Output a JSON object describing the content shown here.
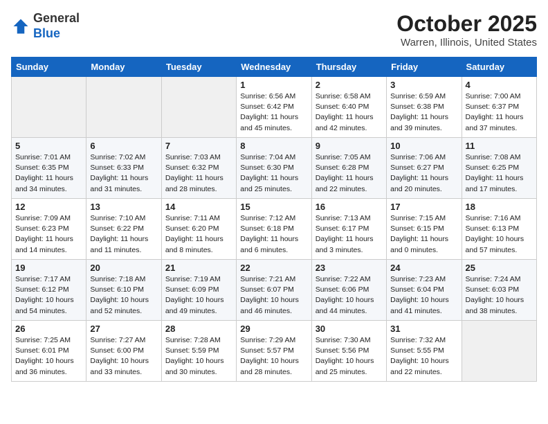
{
  "header": {
    "logo_general": "General",
    "logo_blue": "Blue",
    "title": "October 2025",
    "subtitle": "Warren, Illinois, United States"
  },
  "weekdays": [
    "Sunday",
    "Monday",
    "Tuesday",
    "Wednesday",
    "Thursday",
    "Friday",
    "Saturday"
  ],
  "weeks": [
    [
      {
        "day": "",
        "info": ""
      },
      {
        "day": "",
        "info": ""
      },
      {
        "day": "",
        "info": ""
      },
      {
        "day": "1",
        "info": "Sunrise: 6:56 AM\nSunset: 6:42 PM\nDaylight: 11 hours\nand 45 minutes."
      },
      {
        "day": "2",
        "info": "Sunrise: 6:58 AM\nSunset: 6:40 PM\nDaylight: 11 hours\nand 42 minutes."
      },
      {
        "day": "3",
        "info": "Sunrise: 6:59 AM\nSunset: 6:38 PM\nDaylight: 11 hours\nand 39 minutes."
      },
      {
        "day": "4",
        "info": "Sunrise: 7:00 AM\nSunset: 6:37 PM\nDaylight: 11 hours\nand 37 minutes."
      }
    ],
    [
      {
        "day": "5",
        "info": "Sunrise: 7:01 AM\nSunset: 6:35 PM\nDaylight: 11 hours\nand 34 minutes."
      },
      {
        "day": "6",
        "info": "Sunrise: 7:02 AM\nSunset: 6:33 PM\nDaylight: 11 hours\nand 31 minutes."
      },
      {
        "day": "7",
        "info": "Sunrise: 7:03 AM\nSunset: 6:32 PM\nDaylight: 11 hours\nand 28 minutes."
      },
      {
        "day": "8",
        "info": "Sunrise: 7:04 AM\nSunset: 6:30 PM\nDaylight: 11 hours\nand 25 minutes."
      },
      {
        "day": "9",
        "info": "Sunrise: 7:05 AM\nSunset: 6:28 PM\nDaylight: 11 hours\nand 22 minutes."
      },
      {
        "day": "10",
        "info": "Sunrise: 7:06 AM\nSunset: 6:27 PM\nDaylight: 11 hours\nand 20 minutes."
      },
      {
        "day": "11",
        "info": "Sunrise: 7:08 AM\nSunset: 6:25 PM\nDaylight: 11 hours\nand 17 minutes."
      }
    ],
    [
      {
        "day": "12",
        "info": "Sunrise: 7:09 AM\nSunset: 6:23 PM\nDaylight: 11 hours\nand 14 minutes."
      },
      {
        "day": "13",
        "info": "Sunrise: 7:10 AM\nSunset: 6:22 PM\nDaylight: 11 hours\nand 11 minutes."
      },
      {
        "day": "14",
        "info": "Sunrise: 7:11 AM\nSunset: 6:20 PM\nDaylight: 11 hours\nand 8 minutes."
      },
      {
        "day": "15",
        "info": "Sunrise: 7:12 AM\nSunset: 6:18 PM\nDaylight: 11 hours\nand 6 minutes."
      },
      {
        "day": "16",
        "info": "Sunrise: 7:13 AM\nSunset: 6:17 PM\nDaylight: 11 hours\nand 3 minutes."
      },
      {
        "day": "17",
        "info": "Sunrise: 7:15 AM\nSunset: 6:15 PM\nDaylight: 11 hours\nand 0 minutes."
      },
      {
        "day": "18",
        "info": "Sunrise: 7:16 AM\nSunset: 6:13 PM\nDaylight: 10 hours\nand 57 minutes."
      }
    ],
    [
      {
        "day": "19",
        "info": "Sunrise: 7:17 AM\nSunset: 6:12 PM\nDaylight: 10 hours\nand 54 minutes."
      },
      {
        "day": "20",
        "info": "Sunrise: 7:18 AM\nSunset: 6:10 PM\nDaylight: 10 hours\nand 52 minutes."
      },
      {
        "day": "21",
        "info": "Sunrise: 7:19 AM\nSunset: 6:09 PM\nDaylight: 10 hours\nand 49 minutes."
      },
      {
        "day": "22",
        "info": "Sunrise: 7:21 AM\nSunset: 6:07 PM\nDaylight: 10 hours\nand 46 minutes."
      },
      {
        "day": "23",
        "info": "Sunrise: 7:22 AM\nSunset: 6:06 PM\nDaylight: 10 hours\nand 44 minutes."
      },
      {
        "day": "24",
        "info": "Sunrise: 7:23 AM\nSunset: 6:04 PM\nDaylight: 10 hours\nand 41 minutes."
      },
      {
        "day": "25",
        "info": "Sunrise: 7:24 AM\nSunset: 6:03 PM\nDaylight: 10 hours\nand 38 minutes."
      }
    ],
    [
      {
        "day": "26",
        "info": "Sunrise: 7:25 AM\nSunset: 6:01 PM\nDaylight: 10 hours\nand 36 minutes."
      },
      {
        "day": "27",
        "info": "Sunrise: 7:27 AM\nSunset: 6:00 PM\nDaylight: 10 hours\nand 33 minutes."
      },
      {
        "day": "28",
        "info": "Sunrise: 7:28 AM\nSunset: 5:59 PM\nDaylight: 10 hours\nand 30 minutes."
      },
      {
        "day": "29",
        "info": "Sunrise: 7:29 AM\nSunset: 5:57 PM\nDaylight: 10 hours\nand 28 minutes."
      },
      {
        "day": "30",
        "info": "Sunrise: 7:30 AM\nSunset: 5:56 PM\nDaylight: 10 hours\nand 25 minutes."
      },
      {
        "day": "31",
        "info": "Sunrise: 7:32 AM\nSunset: 5:55 PM\nDaylight: 10 hours\nand 22 minutes."
      },
      {
        "day": "",
        "info": ""
      }
    ]
  ]
}
